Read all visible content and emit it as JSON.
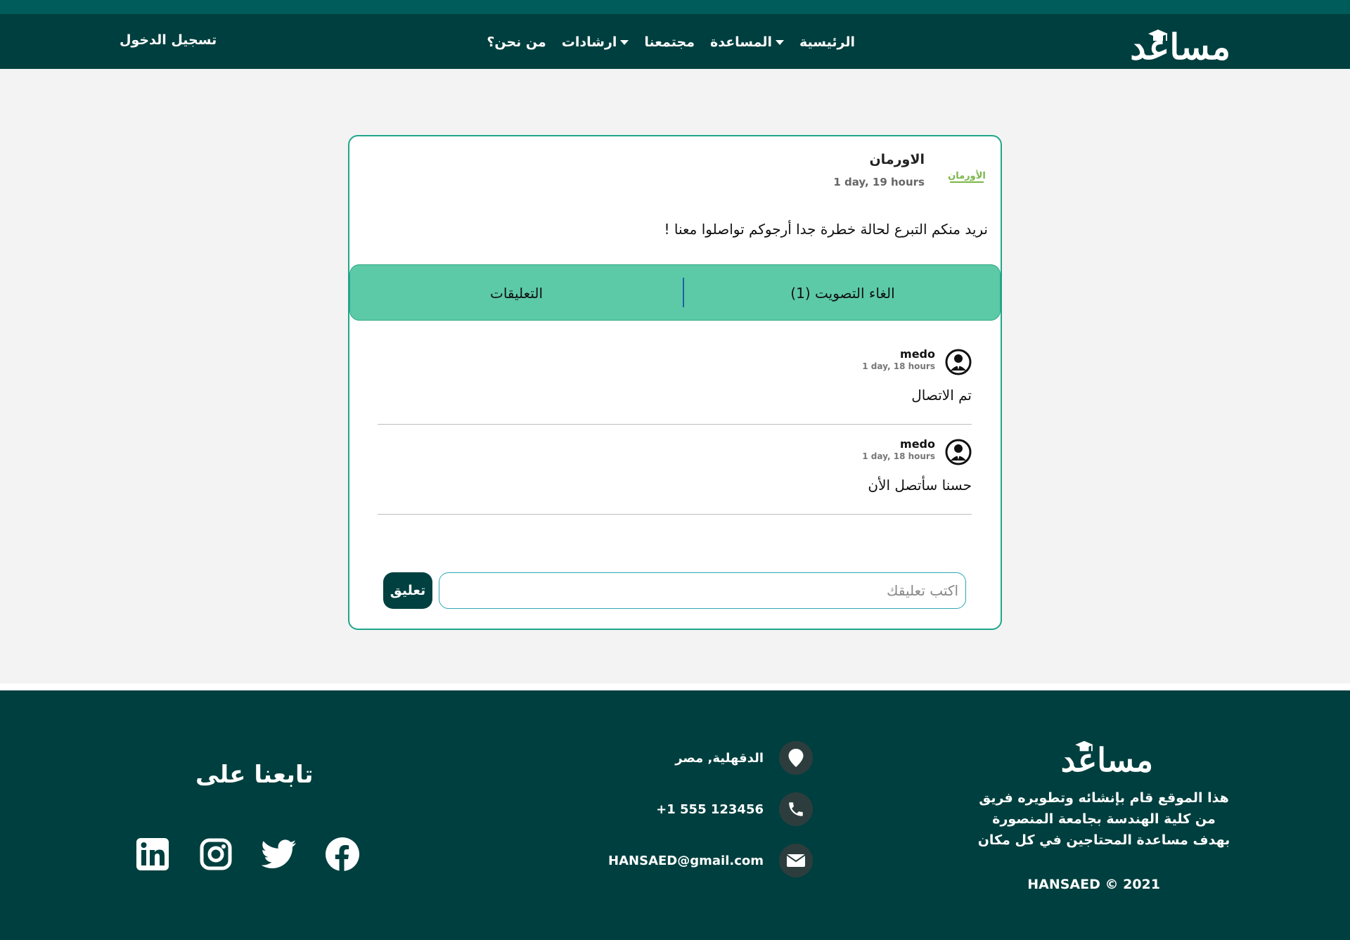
{
  "nav": {
    "logo_text": "مساعد",
    "links": [
      {
        "label": "الرئيسية",
        "has_caret": false
      },
      {
        "label": "المساعدة",
        "has_caret": true
      },
      {
        "label": "مجتمعنا",
        "has_caret": false
      },
      {
        "label": "ارشادات",
        "has_caret": true
      },
      {
        "label": "من نحن؟",
        "has_caret": false
      }
    ],
    "login_label": "تسجيل الدخول"
  },
  "post": {
    "org_name": "الاورمان",
    "org_logo_text": "الأورمان",
    "time": "1 day, 19 hours",
    "text": "نريد منكم التبرع لحالة خطرة جدا أرجوكم تواصلوا معنا !",
    "vote_label": "الغاء التصويت (1)",
    "comments_label": "التعليقات"
  },
  "comments": [
    {
      "user": "medo",
      "time": "1 day, 18 hours",
      "text": "تم الاتصال"
    },
    {
      "user": "medo",
      "time": "1 day, 18 hours",
      "text": "حسنا سأتصل الأن"
    }
  ],
  "comment_form": {
    "placeholder": "اكتب تعليقك",
    "submit_label": "تعليق"
  },
  "footer": {
    "logo_text": "مساعد",
    "about": "هذا الموقع قام بإنشائه وتطويره فريق من كلية الهندسة بجامعة المنصورة بهدف مساعدة المحتاجين في كل مكان",
    "copyright": "HANSAED © 2021",
    "location": "الدقهلية, مصر",
    "phone": "+1 555 123456",
    "email": "HANSAED@gmail.com",
    "follow_title": "تابعنا على",
    "socials": [
      "linkedin-icon",
      "instagram-icon",
      "twitter-icon",
      "facebook-icon"
    ]
  },
  "colors": {
    "nav_bg": "#003f3f",
    "accent": "#5ccaa6",
    "border_accent": "#1fa68a",
    "footer_bg": "#003f3f"
  }
}
